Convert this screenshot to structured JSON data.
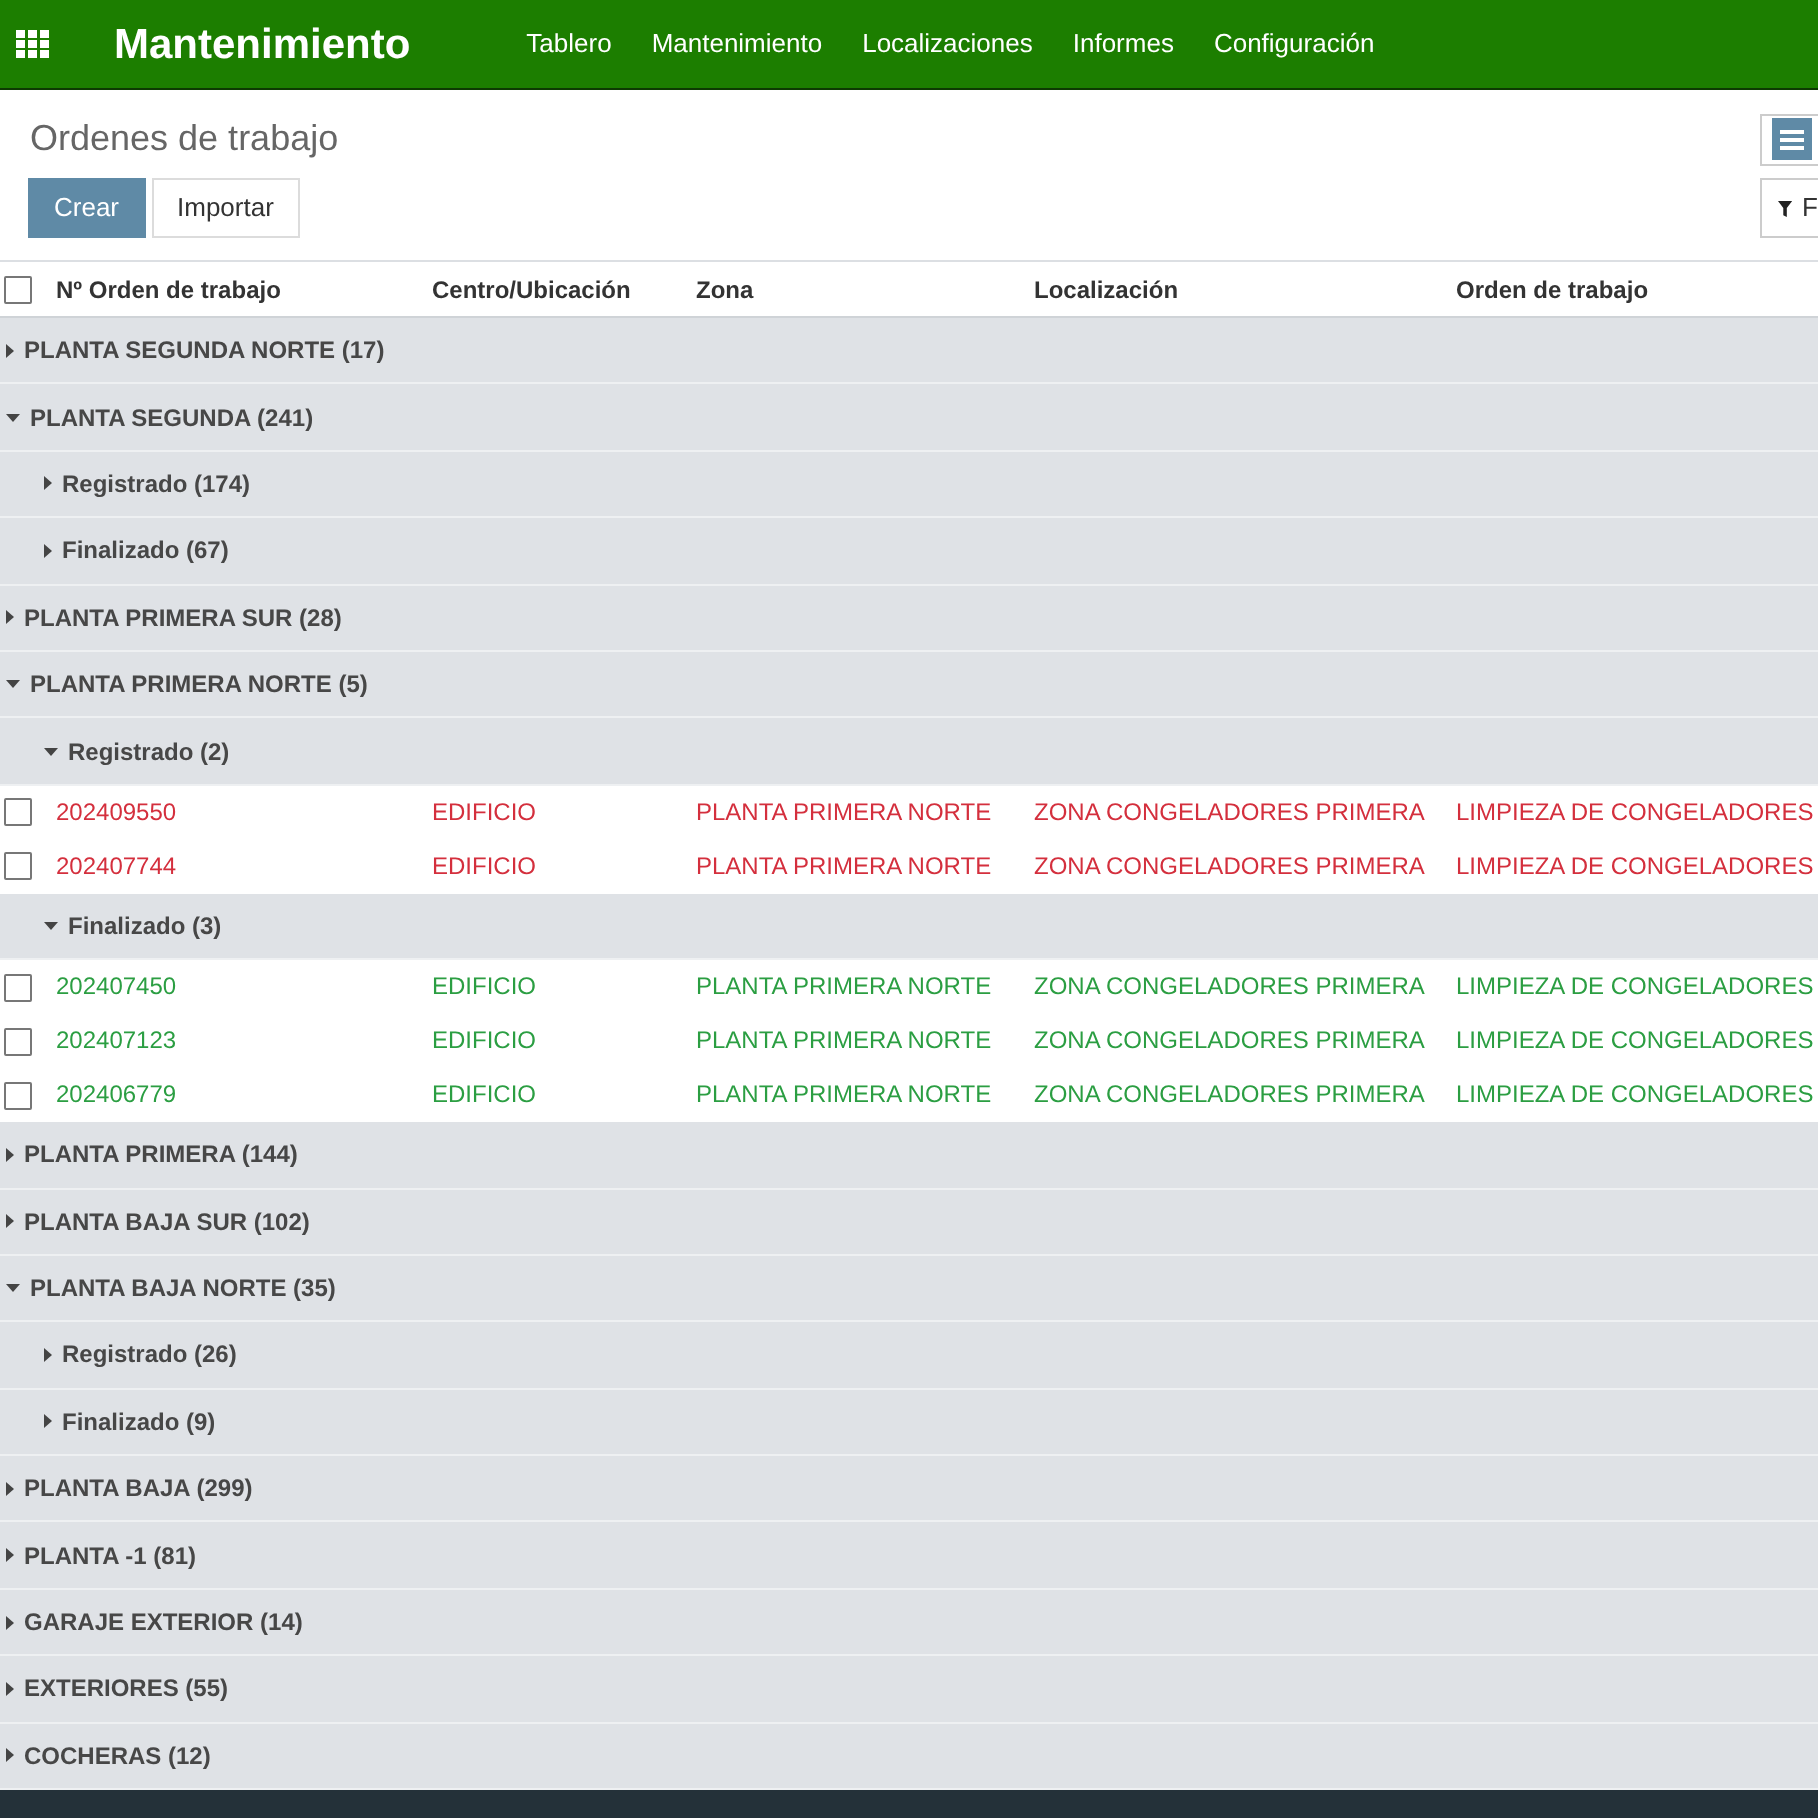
{
  "navbar": {
    "brand": "Mantenimiento",
    "menu": [
      "Tablero",
      "Mantenimiento",
      "Localizaciones",
      "Informes",
      "Configuración"
    ]
  },
  "control_panel": {
    "title": "Ordenes de trabajo",
    "buttons": [
      {
        "label": "Crear",
        "kind": "primary"
      },
      {
        "label": "Importar",
        "kind": "default"
      }
    ],
    "views": [
      {
        "kind": "list",
        "selected": true
      }
    ],
    "filter_button": {
      "label": "F"
    }
  },
  "table": {
    "select_all": {
      "checked": false
    },
    "columns": [
      "Nº Orden de trabajo",
      "Centro/Ubicación",
      "Zona",
      "Localización",
      "Orden de trabajo"
    ],
    "groups": [
      {
        "label": "PLANTA SEGUNDA NORTE (17)",
        "expanded": false
      },
      {
        "label": "PLANTA SEGUNDA (241)",
        "expanded": true,
        "children": [
          {
            "label": "Registrado (174)",
            "expanded": false
          },
          {
            "label": "Finalizado (67)",
            "expanded": false
          }
        ]
      },
      {
        "label": "PLANTA PRIMERA SUR (28)",
        "expanded": false
      },
      {
        "label": "PLANTA PRIMERA NORTE (5)",
        "expanded": true,
        "children": [
          {
            "label": "Registrado (2)",
            "expanded": true,
            "records": [
              {
                "cells": [
                  "202409550",
                  "EDIFICIO",
                  "PLANTA PRIMERA NORTE",
                  "ZONA CONGELADORES PRIMERA",
                  "LIMPIEZA DE CONGELADORES"
                ],
                "checked": false,
                "color": "#d42f3d"
              },
              {
                "cells": [
                  "202407744",
                  "EDIFICIO",
                  "PLANTA PRIMERA NORTE",
                  "ZONA CONGELADORES PRIMERA",
                  "LIMPIEZA DE CONGELADORES"
                ],
                "checked": false,
                "color": "#d42f3d"
              }
            ]
          },
          {
            "label": "Finalizado (3)",
            "expanded": true,
            "records": [
              {
                "cells": [
                  "202407450",
                  "EDIFICIO",
                  "PLANTA PRIMERA NORTE",
                  "ZONA CONGELADORES PRIMERA",
                  "LIMPIEZA DE CONGELADORES"
                ],
                "checked": false,
                "color": "#2b9e42"
              },
              {
                "cells": [
                  "202407123",
                  "EDIFICIO",
                  "PLANTA PRIMERA NORTE",
                  "ZONA CONGELADORES PRIMERA",
                  "LIMPIEZA DE CONGELADORES"
                ],
                "checked": false,
                "color": "#2b9e42"
              },
              {
                "cells": [
                  "202406779",
                  "EDIFICIO",
                  "PLANTA PRIMERA NORTE",
                  "ZONA CONGELADORES PRIMERA",
                  "LIMPIEZA DE CONGELADORES"
                ],
                "checked": false,
                "color": "#2b9e42"
              }
            ]
          }
        ]
      },
      {
        "label": "PLANTA PRIMERA (144)",
        "expanded": false
      },
      {
        "label": "PLANTA BAJA SUR (102)",
        "expanded": false
      },
      {
        "label": "PLANTA BAJA NORTE (35)",
        "expanded": true,
        "children": [
          {
            "label": "Registrado (26)",
            "expanded": false
          },
          {
            "label": "Finalizado (9)",
            "expanded": false
          }
        ]
      },
      {
        "label": "PLANTA BAJA (299)",
        "expanded": false
      },
      {
        "label": "PLANTA -1 (81)",
        "expanded": false
      },
      {
        "label": "GARAJE EXTERIOR (14)",
        "expanded": false
      },
      {
        "label": "EXTERIORES (55)",
        "expanded": false
      },
      {
        "label": "COCHERAS (12)",
        "expanded": false
      }
    ]
  }
}
